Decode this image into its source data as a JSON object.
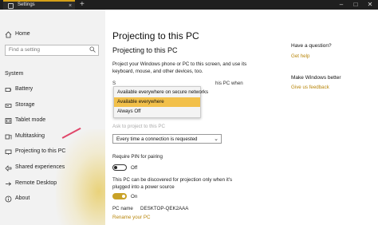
{
  "window": {
    "tab_title": "Settings",
    "tab_close": "×",
    "new_tab": "+",
    "controls": {
      "minimize": "–",
      "maximize": "□",
      "close": "✕"
    }
  },
  "sidebar": {
    "home": "Home",
    "search_placeholder": "Find a setting",
    "section_title": "System",
    "items": [
      {
        "label": "Battery",
        "icon": "battery-icon"
      },
      {
        "label": "Storage",
        "icon": "storage-icon"
      },
      {
        "label": "Tablet mode",
        "icon": "tablet-mode-icon"
      },
      {
        "label": "Multitasking",
        "icon": "multitasking-icon"
      },
      {
        "label": "Projecting to this PC",
        "icon": "projecting-icon"
      },
      {
        "label": "Shared experiences",
        "icon": "shared-experiences-icon"
      },
      {
        "label": "Remote Desktop",
        "icon": "remote-desktop-icon"
      },
      {
        "label": "About",
        "icon": "about-icon"
      }
    ]
  },
  "main": {
    "page_title": "Projecting to this PC",
    "section_heading": "Projecting to this PC",
    "description": "Project your Windows phone or PC to this screen, and use its keyboard, mouse, and other devices, too.",
    "partial_left": "S",
    "partial_right": "his PC when",
    "partial_below": "Ask to project to this PC",
    "availability_menu": {
      "options": [
        {
          "label": "Available everywhere on secure networks",
          "selected": false
        },
        {
          "label": "Available everywhere",
          "selected": true
        },
        {
          "label": "Always Off",
          "selected": false
        }
      ]
    },
    "ask_dropdown": {
      "value": "Every time a connection is requested"
    },
    "require_pin_label": "Require PIN for pairing",
    "require_pin_toggle": {
      "state": "Off"
    },
    "power_text": "This PC can be discovered for projection only when it's plugged into a power source",
    "power_toggle": {
      "state": "On"
    },
    "pc_name_label": "PC name",
    "pc_name_value": "DESKTOP-QEK2AAA",
    "rename_link": "Rename your PC"
  },
  "aside": {
    "question_heading": "Have a question?",
    "get_help": "Get help",
    "improve_heading": "Make Windows better",
    "feedback": "Give us feedback"
  },
  "colors": {
    "accent": "#c9a227",
    "selection": "#f2c04a",
    "link": "#b8860b",
    "annotation_arrow": "#e0476a"
  }
}
